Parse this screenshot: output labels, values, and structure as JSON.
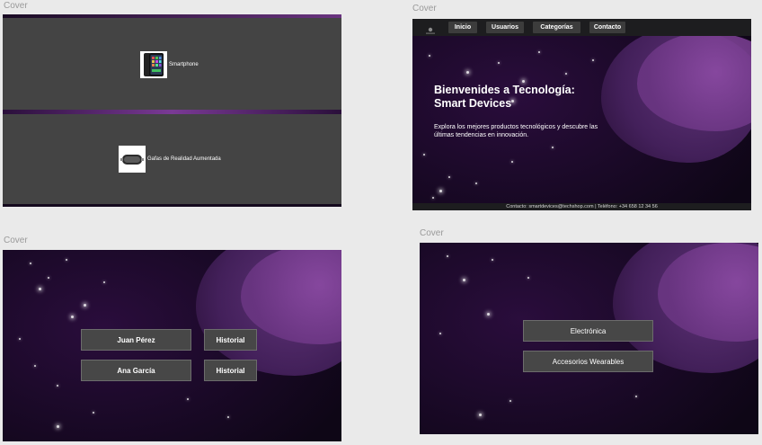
{
  "frames": {
    "f1": {
      "label": "Cover"
    },
    "f2": {
      "label": "Cover"
    },
    "f3": {
      "label": "Cover"
    },
    "f4": {
      "label": "Cover"
    }
  },
  "products": [
    {
      "name": "Smartphone",
      "icon": "smartphone-icon"
    },
    {
      "name": "Gafas de Realidad Aumentada",
      "icon": "ar-glasses-icon"
    }
  ],
  "nav": {
    "logo": "logo-icon",
    "items": [
      "Inicio",
      "Usuarios",
      "Categorías",
      "Contacto"
    ]
  },
  "hero": {
    "title_line1": "Bienvenides a Tecnología:",
    "title_line2": "Smart Devices",
    "subtitle": "Explora los mejores productos tecnológicos y descubre las últimas tendencias en innovación."
  },
  "footer": {
    "text": "Contacto: smartdevices@techshop.com | Teléfono: +34 658 12 34 56"
  },
  "users": [
    {
      "name": "Juan Pérez",
      "action": "Historial"
    },
    {
      "name": "Ana García",
      "action": "Historial"
    }
  ],
  "categories": [
    "Electrónica",
    "Accesorios Wearables"
  ],
  "colors": {
    "background": "#eaeaea",
    "deep_purple": "#1a0927",
    "blob_purple": "#7a3a95",
    "panel_gray": "#444444",
    "button_gray": "#474747"
  }
}
